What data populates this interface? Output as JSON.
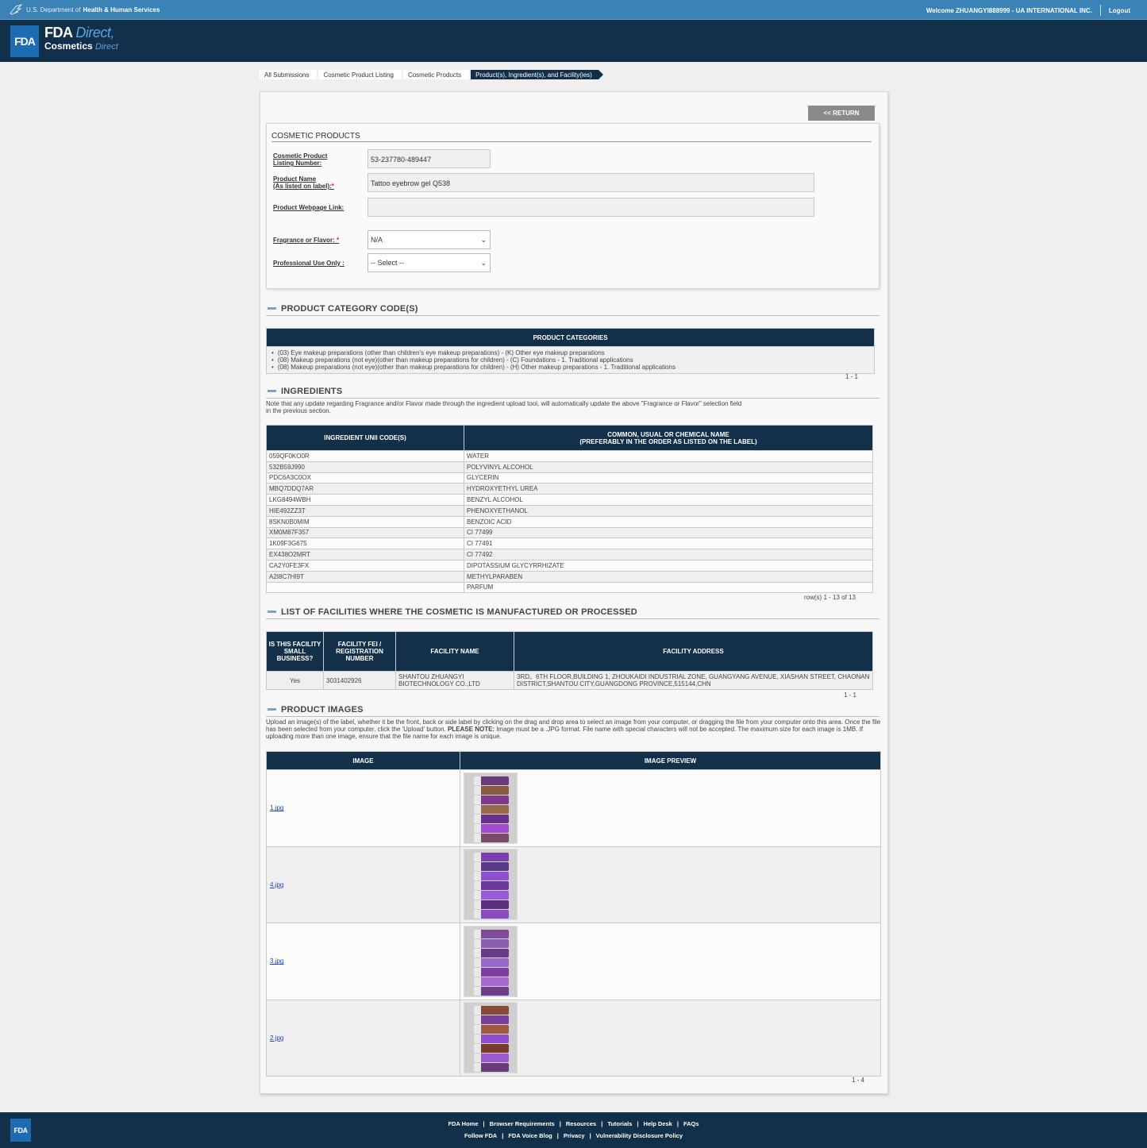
{
  "header": {
    "hhs_prefix": "U.S. Department of",
    "hhs_name": "Health & Human Services",
    "welcome": "Welcome ZHUANGYI888999 - UA INTERNATIONAL INC.",
    "logout": "Logout",
    "fda_logo": "FDA",
    "title_bold": "FDA",
    "title_italic": "Direct,",
    "subtitle_bold": "Cosmetics",
    "subtitle_italic": "Direct"
  },
  "breadcrumb": [
    "All Submissions",
    "Cosmetic Product Listing",
    "Cosmetic Products",
    "Product(s), Ingredient(s), and Facility(ies)"
  ],
  "return_label": "<< RETURN",
  "form": {
    "title": "COSMETIC PRODUCTS",
    "listing_label_1": "Cosmetic Product",
    "listing_label_2": "Listing Number:",
    "listing_value": "53-237780-489447",
    "name_label_1": "Product Name",
    "name_label_2": "(As listed on label):",
    "name_value": "Tattoo eyebrow gel Q538",
    "webpage_label": "Product Webpage Link:",
    "webpage_value": "",
    "fragrance_label": "Fragrance or Flavor:",
    "fragrance_value": "N/A",
    "professional_label": "Professional Use Only :",
    "professional_value": "-- Select --",
    "required_mark": "*"
  },
  "categories": {
    "heading": "PRODUCT CATEGORY CODE(S)",
    "table_header": "PRODUCT CATEGORIES",
    "items": [
      "(03) Eye makeup preparations (other than children's eye makeup preparations) - (K) Other eye makeup preparations",
      "(08) Makeup preparations (not eye)(other than makeup preparations for children) - (C) Foundations - 1. Traditional applications",
      "(08) Makeup preparations (not eye)(other than makeup preparations for children) - (H) Other makeup preparations - 1. Traditional applications"
    ],
    "pager": "1 - 1"
  },
  "ingredients": {
    "heading": "INGREDIENTS",
    "note_1": "Note that any update regarding Fragrance and/or Flavor made through the ingredient upload tool, will automatically update the above \"Fragrance or Flavor\" selection field",
    "note_2": "in the previous section.",
    "col_1": "INGREDIENT UNII CODE(S)",
    "col_2_line1": "COMMON, USUAL OR CHEMICAL NAME",
    "col_2_line2": "(PREFERABLY IN THE ORDER AS LISTED ON THE LABEL)",
    "rows": [
      [
        "059QF0KO0R",
        "WATER"
      ],
      [
        "532B59J990",
        "POLYVINYL ALCOHOL"
      ],
      [
        "PDC6A3C0OX",
        "GLYCERIN"
      ],
      [
        "MBQ7DDQ7AR",
        "HYDROXYETHYL UREA"
      ],
      [
        "LKG8494WBH",
        "BENZYL ALCOHOL"
      ],
      [
        "HIE492ZZ3T",
        "PHENOXYETHANOL"
      ],
      [
        "8SKN0B0MIM",
        "BENZOIC ACID"
      ],
      [
        "XM0M87F357",
        "CI 77499"
      ],
      [
        "1K09F3G675",
        "CI 77491"
      ],
      [
        "EX438O2MRT",
        "CI 77492"
      ],
      [
        "CA2Y0FE3FX",
        "DIPOTASSIUM GLYCYRRHIZATE"
      ],
      [
        "A2I8C7HI9T",
        "METHYLPARABEN"
      ],
      [
        "",
        "PARFUM"
      ]
    ],
    "pager": "row(s) 1 - 13 of 13"
  },
  "facilities": {
    "heading": "LIST OF FACILITIES WHERE THE COSMETIC IS MANUFACTURED OR PROCESSED",
    "col_1": "IS THIS FACILITY SMALL BUSINESS?",
    "col_2": "FACILITY FEI / REGISTRATION NUMBER",
    "col_3": "FACILITY NAME",
    "col_4": "FACILITY ADDRESS",
    "small_business": "Yes",
    "fei": "3031402926",
    "name": "SHANTOU ZHUANGYI BIOTECHNOLOGY CO.,LTD",
    "address": "3RD、6TH FLOOR,BUILDING 1, ZHOUKAIDI INDUSTRIAL ZONE, GUANGYANG AVENUE, XIASHAN STREET, CHAONAN DISTRICT,SHANTOU CITY,GUANGDONG PROVINCE,515144,CHN",
    "pager": "1 - 1"
  },
  "images": {
    "heading": "PRODUCT IMAGES",
    "note_start": "Upload an image(s) of the label, whether it be the front, back or side label by clicking on the drag and drop area to select an image from your computer, or dragging the file from your computer onto this area. Once the file has been selected from your computer, click the 'Upload' button.",
    "note_bold": "PLEASE NOTE:",
    "note_end": "Image must be a .JPG format. File name with special characters will not be accepted. The maximum size for each image is 1MB. If uploading more than one image, ensure that the file name for each image is unique.",
    "col_1": "IMAGE",
    "col_2": "IMAGE PREVIEW",
    "files": [
      "1.jpg",
      "4.jpg",
      "3.jpg",
      "2.jpg"
    ],
    "pager": "1 - 4"
  },
  "footer": {
    "logo": "FDA",
    "row1": [
      "FDA Home",
      "Browser Requirements",
      "Resources",
      "Tutorials",
      "Help Desk",
      "FAQs"
    ],
    "row2": [
      "Follow FDA",
      "FDA Voice Blog",
      "Privacy",
      "Vulnerability Disclosure Policy"
    ]
  },
  "colors": {
    "navy": "#12304a",
    "hhs_blue": "#3b82b6",
    "accent": "#1d6bb3"
  }
}
